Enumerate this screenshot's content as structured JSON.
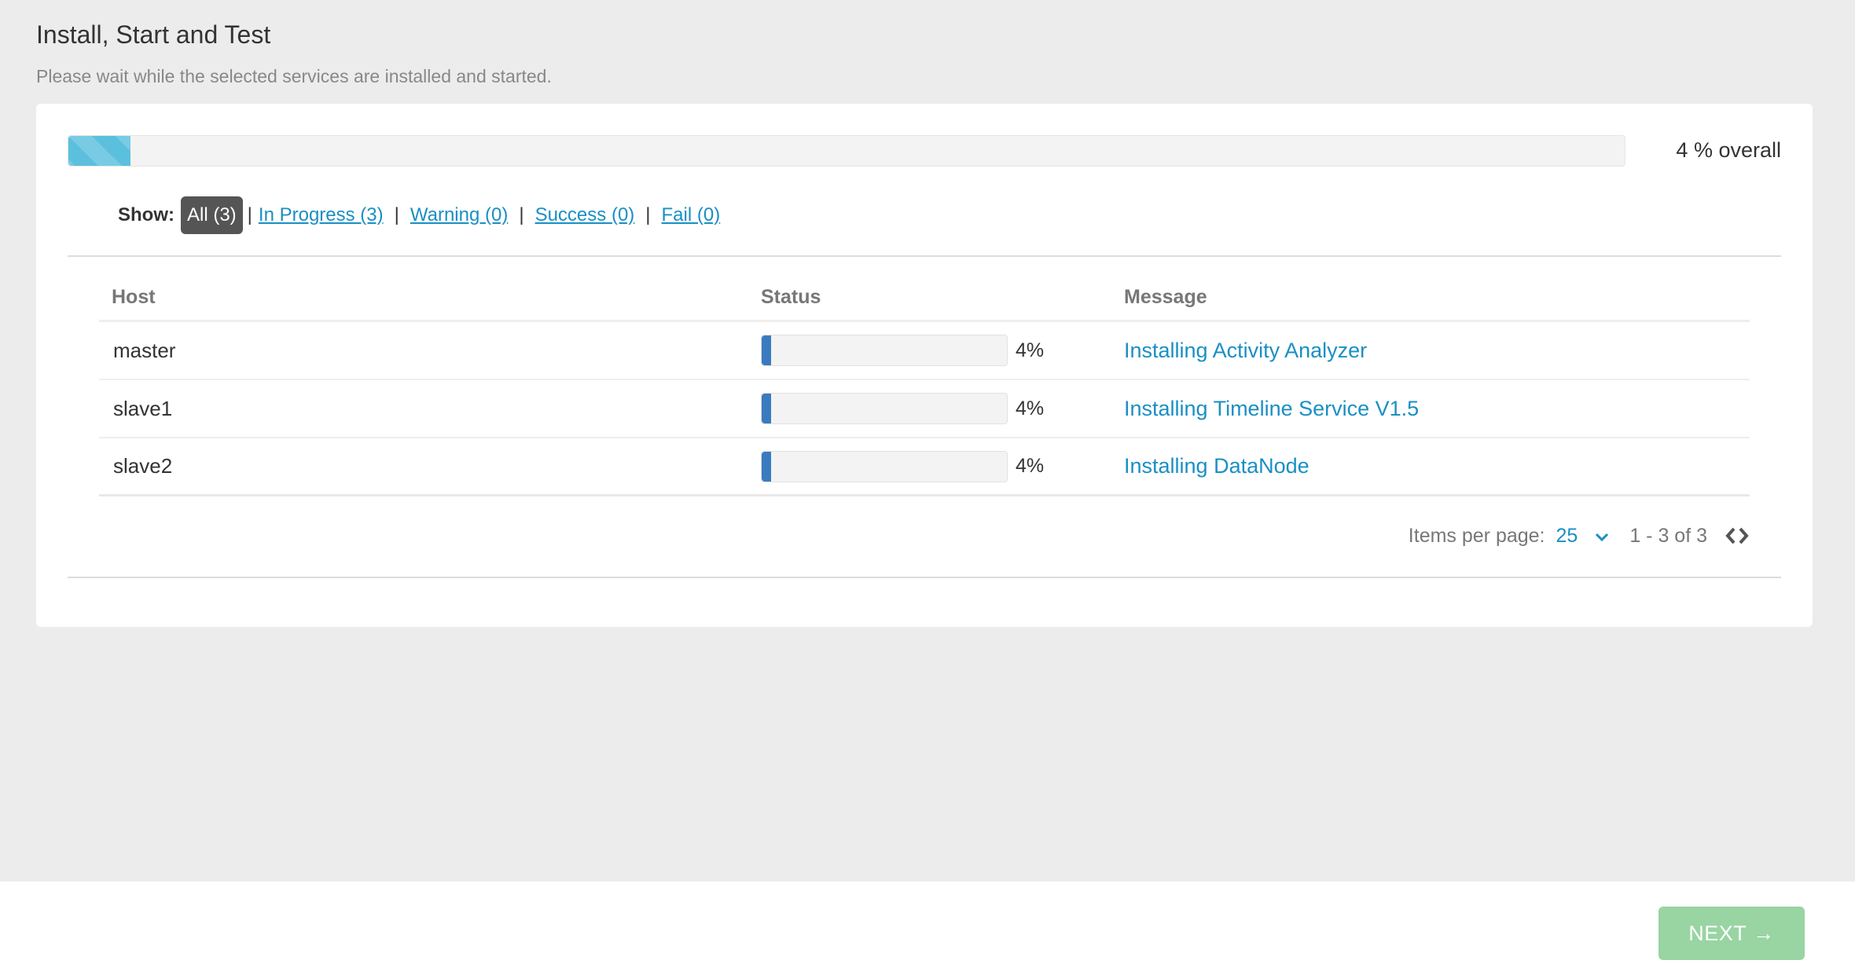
{
  "header": {
    "title": "Install, Start and Test",
    "subtitle": "Please wait while the selected services are installed and started."
  },
  "overall_progress": {
    "percent": 4,
    "label": "4 % overall"
  },
  "filters": {
    "label": "Show:",
    "items": [
      {
        "label": "All (3)",
        "active": true
      },
      {
        "label": "In Progress (3)",
        "active": false
      },
      {
        "label": "Warning (0)",
        "active": false
      },
      {
        "label": "Success (0)",
        "active": false
      },
      {
        "label": "Fail (0)",
        "active": false
      }
    ],
    "separator": "|"
  },
  "table": {
    "columns": [
      "Host",
      "Status",
      "Message"
    ],
    "rows": [
      {
        "host": "master",
        "progress": 4,
        "progress_label": "4%",
        "message": "Installing Activity Analyzer"
      },
      {
        "host": "slave1",
        "progress": 4,
        "progress_label": "4%",
        "message": "Installing Timeline Service V1.5"
      },
      {
        "host": "slave2",
        "progress": 4,
        "progress_label": "4%",
        "message": "Installing DataNode"
      }
    ]
  },
  "pagination": {
    "items_per_page_label": "Items per page:",
    "items_per_page_value": "25",
    "range_label": "1 - 3 of 3"
  },
  "footer": {
    "next_label": "NEXT",
    "next_arrow": "→"
  },
  "colors": {
    "overall_bar": "#5bc0de",
    "row_bar": "#3a7bbf",
    "link": "#1a8fc4",
    "next_button": "#99d4a3"
  }
}
